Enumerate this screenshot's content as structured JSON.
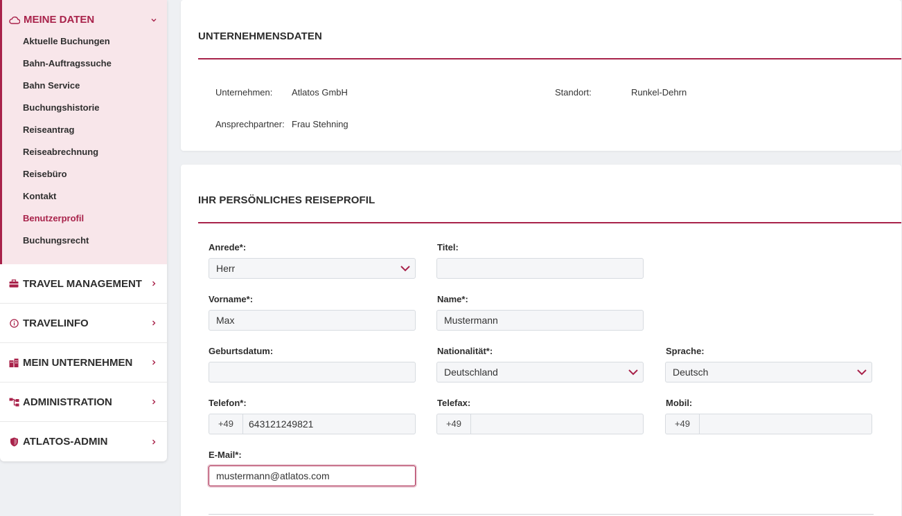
{
  "sidebar": {
    "open_section": {
      "label": "MEINE DATEN",
      "icon": "cloud-icon",
      "items": [
        {
          "label": "Aktuelle Buchungen"
        },
        {
          "label": "Bahn-Auftragssuche"
        },
        {
          "label": "Bahn Service"
        },
        {
          "label": "Buchungshistorie"
        },
        {
          "label": "Reiseantrag"
        },
        {
          "label": "Reiseabrechnung"
        },
        {
          "label": "Reisebüro"
        },
        {
          "label": "Kontakt"
        },
        {
          "label": "Benutzerprofil",
          "active": true
        },
        {
          "label": "Buchungsrecht"
        }
      ]
    },
    "sections": [
      {
        "label": "TRAVEL MANAGEMENT",
        "icon": "briefcase-icon"
      },
      {
        "label": "TRAVELINFO",
        "icon": "info-icon"
      },
      {
        "label": "MEIN UNTERNEHMEN",
        "icon": "buildings-icon"
      },
      {
        "label": "ADMINISTRATION",
        "icon": "sitemap-icon"
      },
      {
        "label": "ATLATOS-ADMIN",
        "icon": "shield-icon"
      }
    ]
  },
  "company": {
    "title": "UNTERNEHMENSDATEN",
    "company_label": "Unternehmen:",
    "company_value": "Atlatos GmbH",
    "location_label": "Standort:",
    "location_value": "Runkel-Dehrn",
    "contact_label": "Ansprechpartner:",
    "contact_value": "Frau Stehning"
  },
  "profile": {
    "title": "IHR PERSÖNLICHES REISEPROFIL",
    "salutation_label": "Anrede*:",
    "salutation_value": "Herr",
    "title_label": "Titel:",
    "title_value": "",
    "firstname_label": "Vorname*:",
    "firstname_value": "Max",
    "lastname_label": "Name*:",
    "lastname_value": "Mustermann",
    "birthdate_label": "Geburtsdatum:",
    "birthdate_value": "",
    "nationality_label": "Nationalität*:",
    "nationality_value": "Deutschland",
    "language_label": "Sprache:",
    "language_value": "Deutsch",
    "phone_label": "Telefon*:",
    "phone_prefix": "+49",
    "phone_value": "643121249821",
    "fax_label": "Telefax:",
    "fax_prefix": "+49",
    "fax_value": "",
    "mobile_label": "Mobil:",
    "mobile_prefix": "+49",
    "mobile_value": "",
    "email_label": "E-Mail*:",
    "email_value": "mustermann@atlatos.com"
  },
  "colors": {
    "accent": "#a8224a",
    "sidebar_open_bg": "#f8e6ea"
  }
}
